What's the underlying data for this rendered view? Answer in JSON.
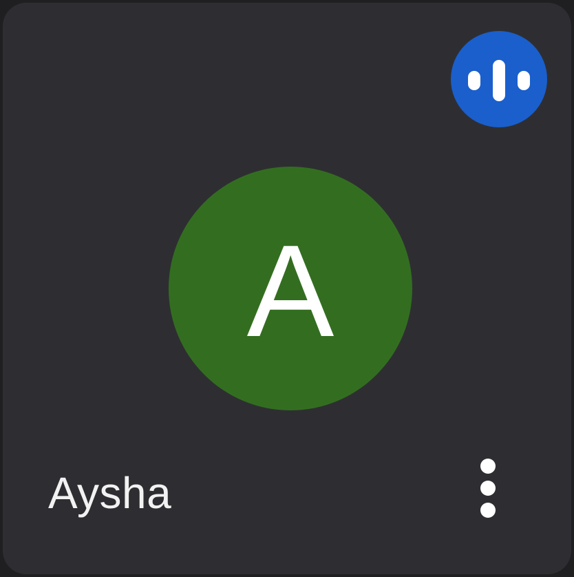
{
  "participant": {
    "name": "Aysha",
    "initial": "A",
    "avatar_color": "#336e20"
  },
  "speaking_indicator": {
    "icon": "audio-level-icon",
    "color": "#1a5fcc"
  },
  "more_options": {
    "icon": "more-vert-icon"
  },
  "colors": {
    "tile_background": "#2e2e32",
    "page_background": "#1f1f22",
    "text": "#f2f2f2"
  }
}
